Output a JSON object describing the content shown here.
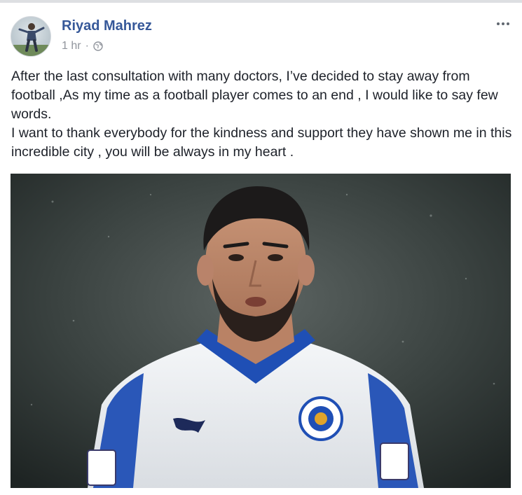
{
  "post": {
    "author": "Riyad Mahrez",
    "timestamp": "1 hr",
    "separator": "·",
    "privacy_icon": "globe-icon",
    "more_icon": "more-options-icon",
    "body_paragraphs": [
      "After the last consultation with many doctors, I’ve decided to stay away from football ,As my time as a football player comes to an end , I would like to say few words.",
      "I want to thank everybody for the kindness and support they have shown me in this incredible city , you will be always in my heart ."
    ]
  },
  "colors": {
    "author_link": "#365899",
    "meta_text": "#90949c",
    "body_text": "#1d2129"
  }
}
